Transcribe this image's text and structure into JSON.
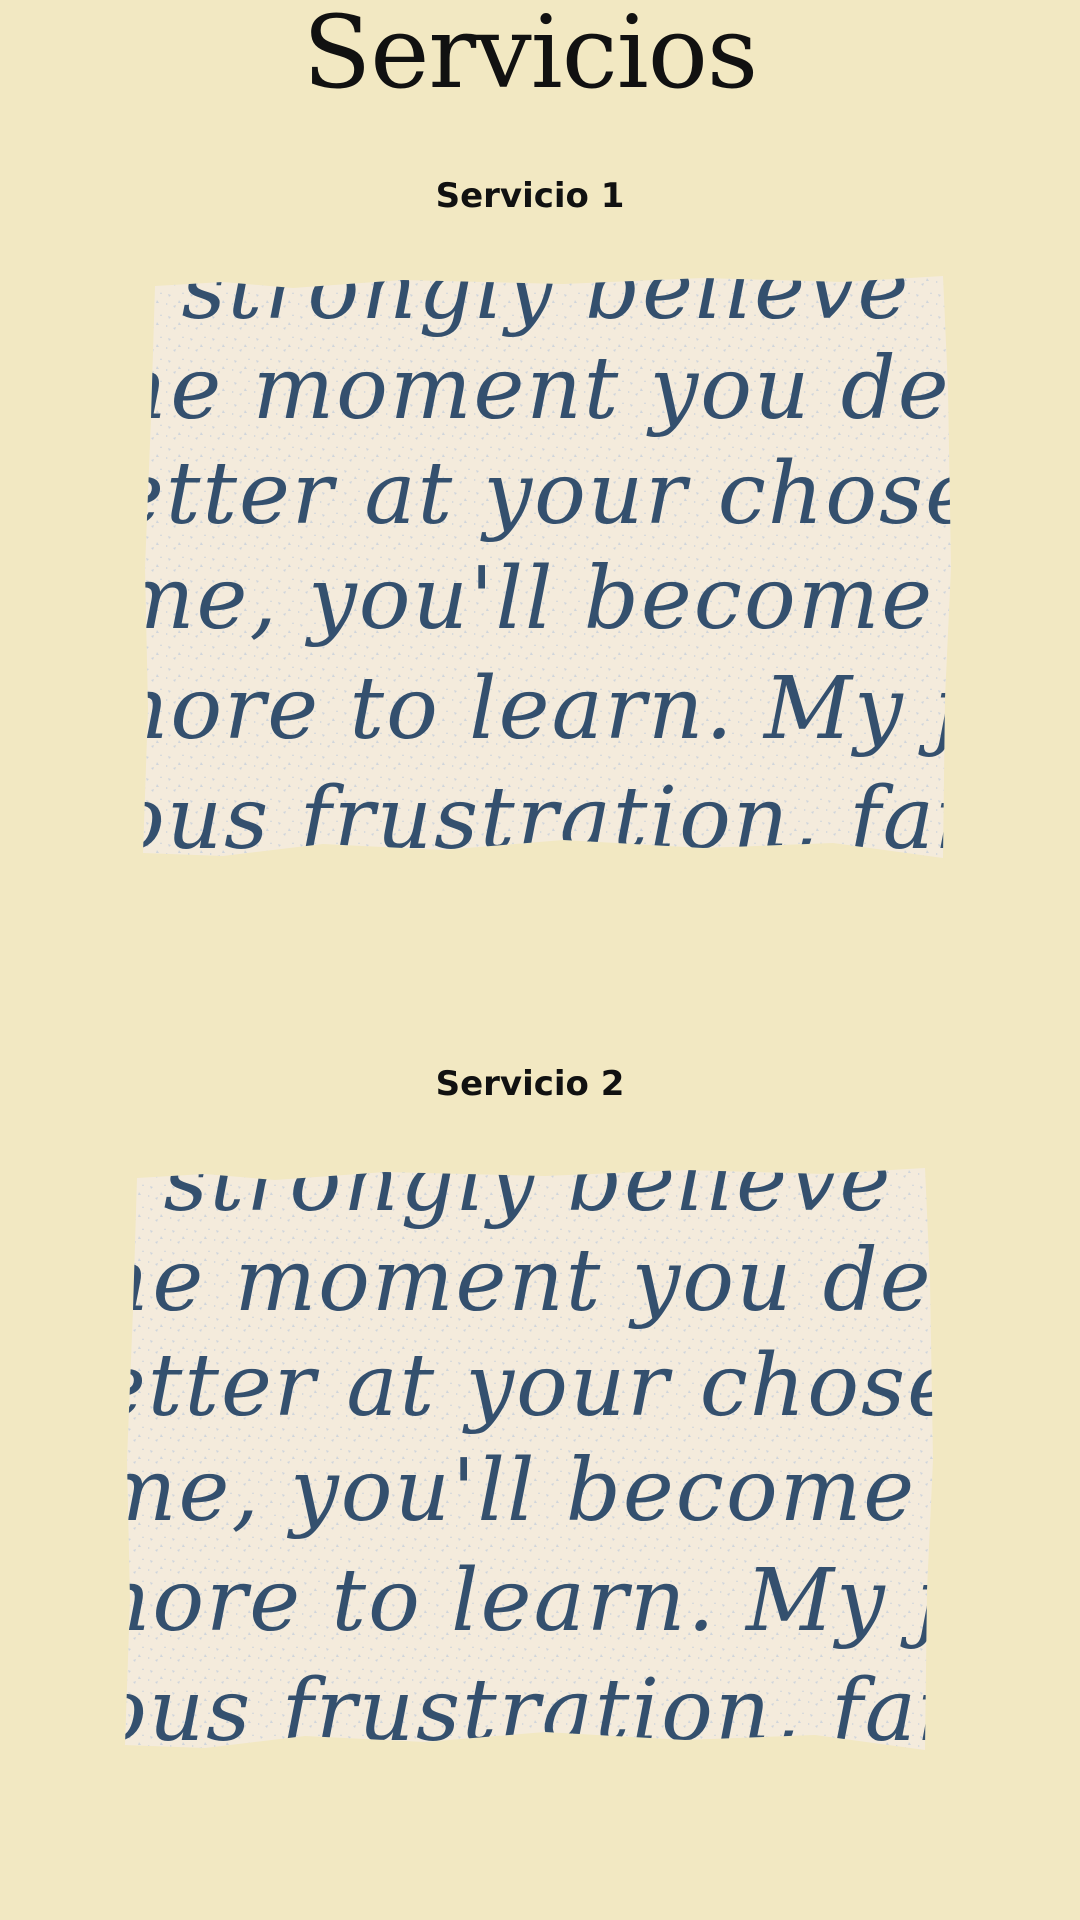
{
  "page": {
    "title": "Servicios"
  },
  "services": [
    {
      "heading": "Servicio 1",
      "image_lines": [
        ". strongly believe tha",
        "he moment you decid",
        "etter at your chosen",
        "me, you'll become mo",
        "nore to learn. My jo",
        "ous frustration, fail"
      ]
    },
    {
      "heading": "Servicio 2",
      "image_lines": [
        ". strongly believe tha",
        "he moment you decid",
        "etter at your chosen",
        "me, you'll become mo",
        "nore to learn. My jo",
        "ous frustration, fail"
      ]
    }
  ],
  "colors": {
    "background": "#f2e8c2",
    "paper": "#f4ebdc",
    "ink": "#34506e",
    "speckle": "#c9d1db"
  }
}
